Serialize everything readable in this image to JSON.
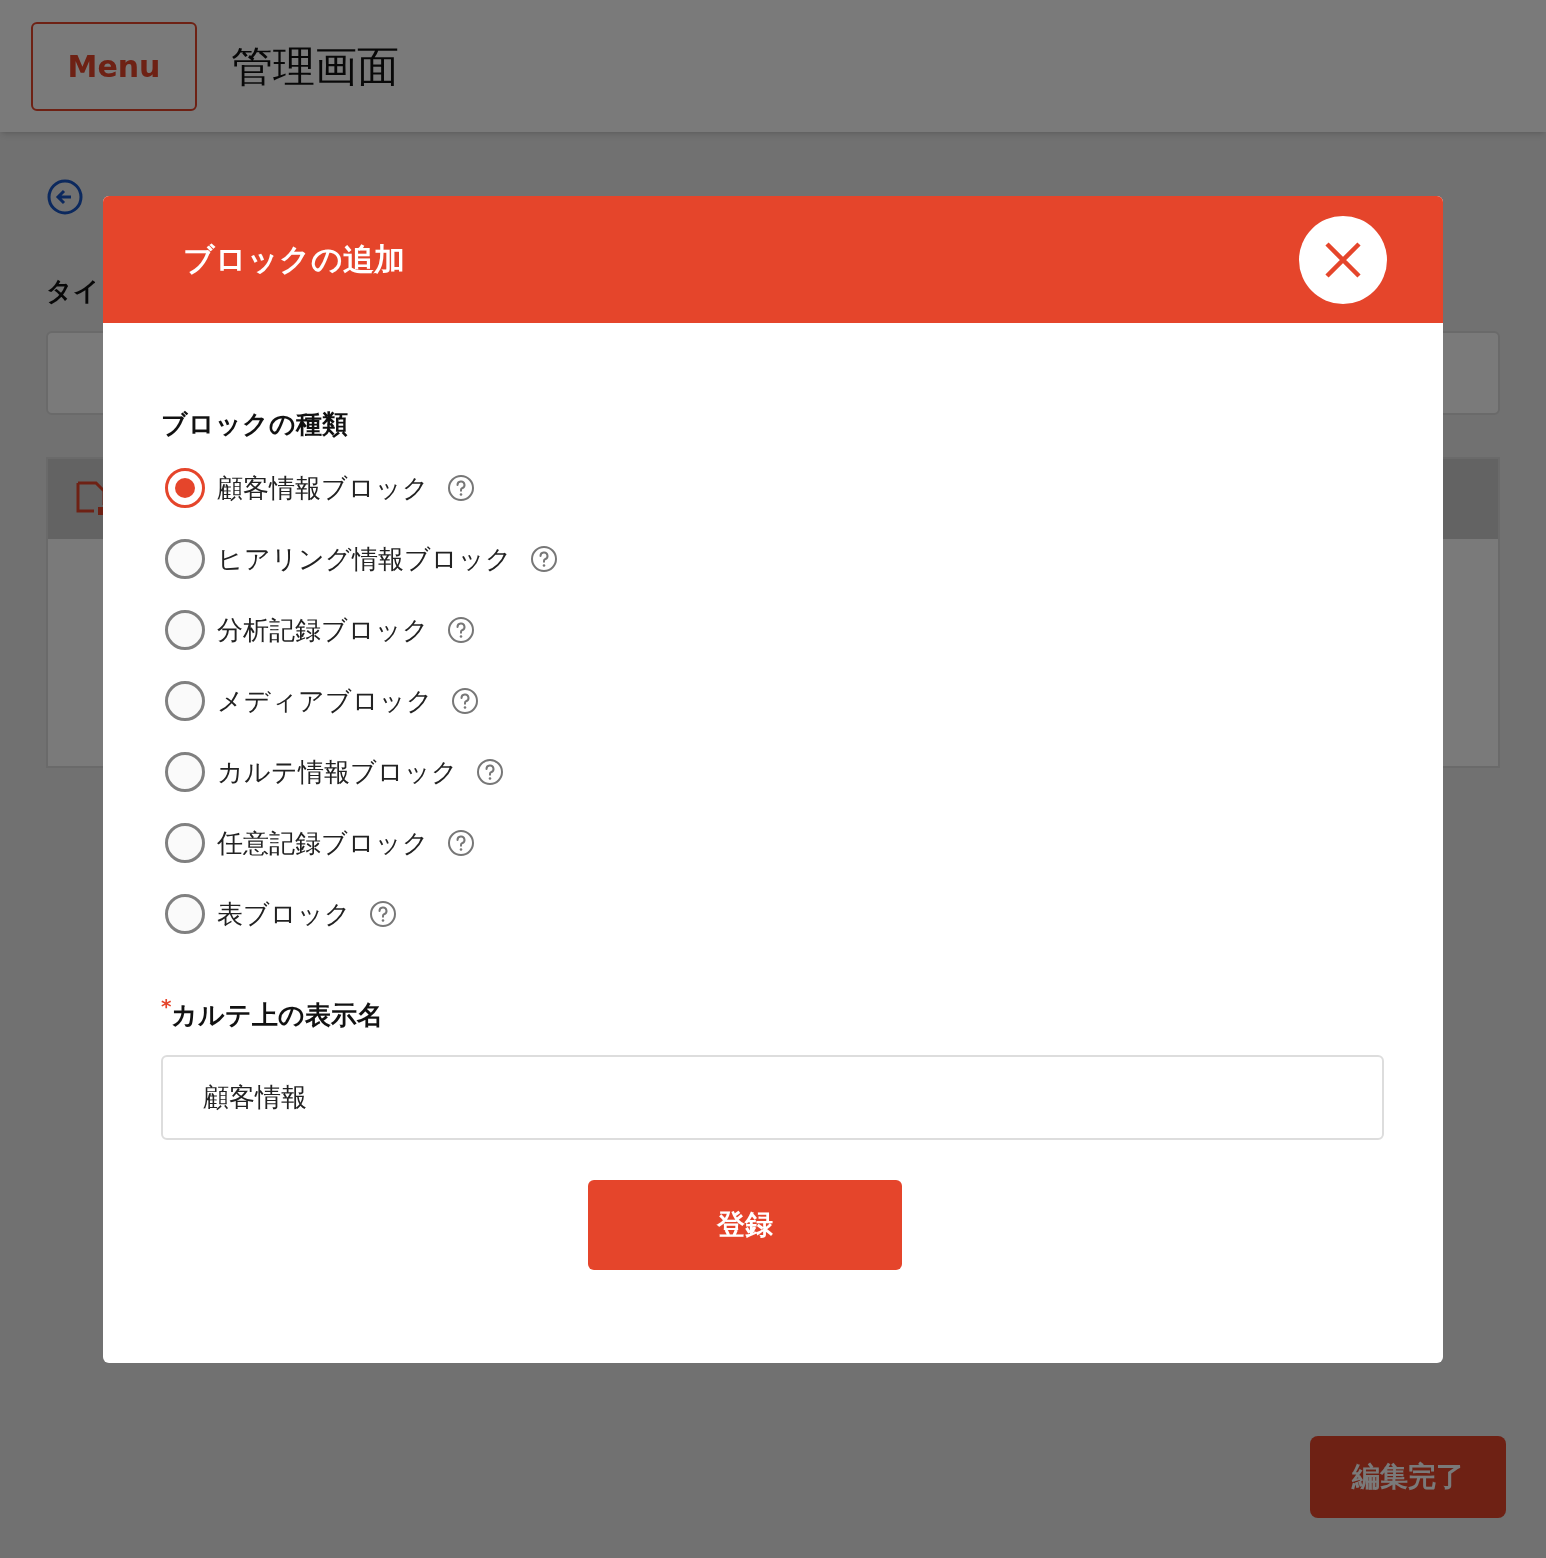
{
  "header": {
    "menu_button": "Menu",
    "title": "管理画面"
  },
  "page": {
    "field_label": "タイ",
    "done_button": "編集完了"
  },
  "modal": {
    "title": "ブロックの追加",
    "type_label": "ブロックの種類",
    "options": [
      {
        "label": "顧客情報ブロック",
        "selected": true
      },
      {
        "label": "ヒアリング情報ブロック",
        "selected": false
      },
      {
        "label": "分析記録ブロック",
        "selected": false
      },
      {
        "label": "メディアブロック",
        "selected": false
      },
      {
        "label": "カルテ情報ブロック",
        "selected": false
      },
      {
        "label": "任意記録ブロック",
        "selected": false
      },
      {
        "label": "表ブロック",
        "selected": false
      }
    ],
    "name_label": {
      "required_mark": "*",
      "text": "カルテ上の表示名"
    },
    "name_value": "顧客情報",
    "submit_button": "登録"
  }
}
